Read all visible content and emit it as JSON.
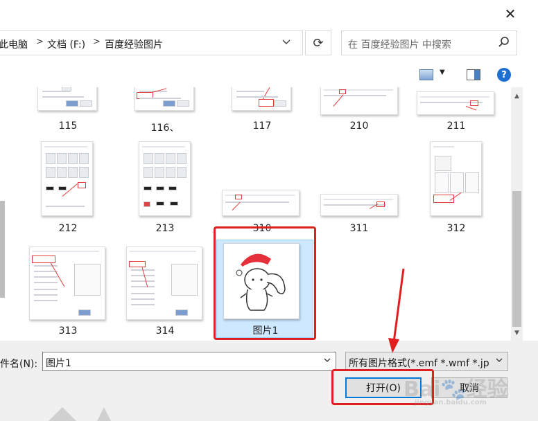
{
  "window": {
    "close_glyph": "✕"
  },
  "address": {
    "crumbs": [
      "此电脑",
      "文档 (F:)",
      "百度经验图片"
    ],
    "separator": ">",
    "refresh_glyph": "⟳"
  },
  "search": {
    "placeholder": "在 百度经验图片 中搜索"
  },
  "toolbar": {
    "help_glyph": "?",
    "view_dropdown_glyph": "▼"
  },
  "files": [
    {
      "name": "115"
    },
    {
      "name": "116、"
    },
    {
      "name": "117"
    },
    {
      "name": "210"
    },
    {
      "name": "211"
    },
    {
      "name": "212"
    },
    {
      "name": "213"
    },
    {
      "name": "310"
    },
    {
      "name": "311"
    },
    {
      "name": "312"
    },
    {
      "name": "313"
    },
    {
      "name": "314"
    },
    {
      "name": "图片1",
      "selected": true
    }
  ],
  "bottom": {
    "filename_label": "件名(N):",
    "filename_value": "图片1",
    "filetype_value": "所有图片格式(*.emf *.wmf *.jp",
    "open_button": "打开(O)",
    "cancel_button": "取消"
  },
  "watermark": {
    "brand": "Bai",
    "paw": "🐾",
    "suffix": "经验",
    "url": "jingyan.baidu.com"
  },
  "colors": {
    "accent": "#0078d7",
    "highlight_red": "#e02020",
    "selection": "#cde8ff"
  }
}
